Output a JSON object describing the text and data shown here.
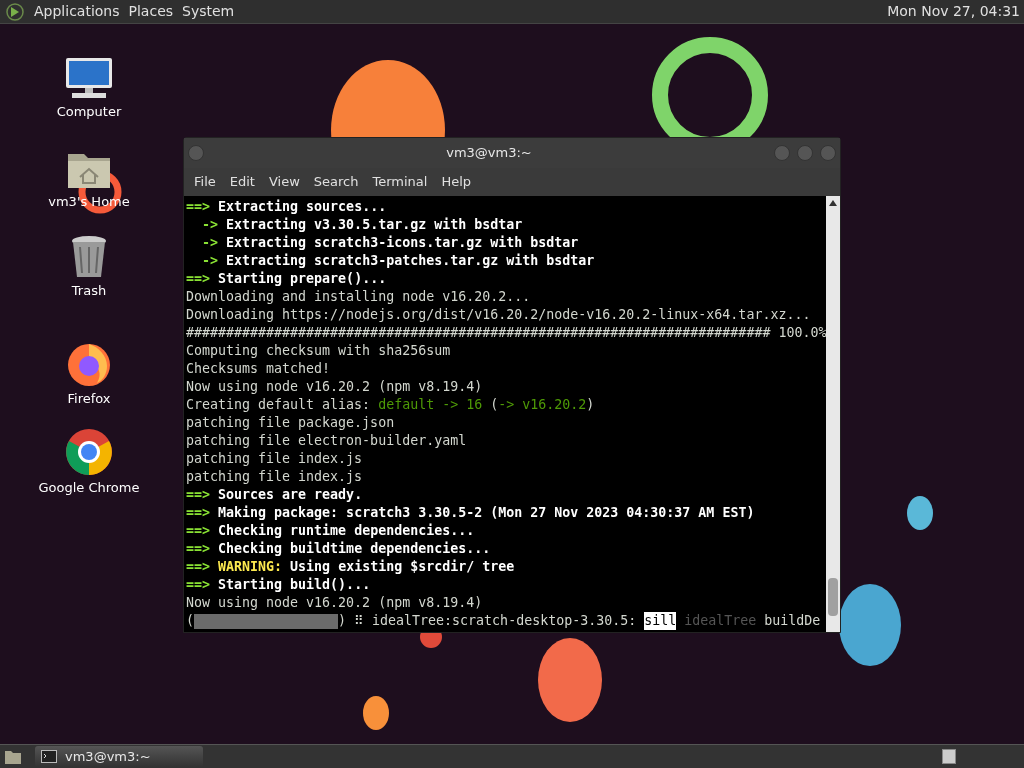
{
  "top_panel": {
    "menus": [
      "Applications",
      "Places",
      "System"
    ],
    "clock": "Mon Nov 27, 04:31"
  },
  "desktop_icons": [
    {
      "kind": "computer",
      "label": "Computer"
    },
    {
      "kind": "home",
      "label": "vm3's Home"
    },
    {
      "kind": "trash",
      "label": "Trash"
    },
    {
      "kind": "firefox",
      "label": "Firefox"
    },
    {
      "kind": "chrome",
      "label": "Google Chrome"
    }
  ],
  "window": {
    "title": "vm3@vm3:~",
    "menu": [
      "File",
      "Edit",
      "View",
      "Search",
      "Terminal",
      "Help"
    ],
    "lines": [
      [
        {
          "kind": "arrow",
          "text": "==>"
        },
        {
          "kind": "bold",
          "text": " Extracting sources..."
        }
      ],
      [
        {
          "kind": "arrow",
          "text": "  ->"
        },
        {
          "kind": "bold",
          "text": " Extracting v3.30.5.tar.gz with bsdtar"
        }
      ],
      [
        {
          "kind": "arrow",
          "text": "  ->"
        },
        {
          "kind": "bold",
          "text": " Extracting scratch3-icons.tar.gz with bsdtar"
        }
      ],
      [
        {
          "kind": "arrow",
          "text": "  ->"
        },
        {
          "kind": "bold",
          "text": " Extracting scratch3-patches.tar.gz with bsdtar"
        }
      ],
      [
        {
          "kind": "arrow",
          "text": "==>"
        },
        {
          "kind": "bold",
          "text": " Starting prepare()..."
        }
      ],
      [
        {
          "kind": "plain",
          "text": "Downloading and installing node v16.20.2..."
        }
      ],
      [
        {
          "kind": "plain",
          "text": "Downloading https://nodejs.org/dist/v16.20.2/node-v16.20.2-linux-x64.tar.xz..."
        }
      ],
      [
        {
          "kind": "plain",
          "text": "######################################################################### 100.0%"
        }
      ],
      [
        {
          "kind": "plain",
          "text": "Computing checksum with sha256sum"
        }
      ],
      [
        {
          "kind": "plain",
          "text": "Checksums matched!"
        }
      ],
      [
        {
          "kind": "plain",
          "text": "Now using node v16.20.2 (npm v8.19.4)"
        }
      ],
      [
        {
          "kind": "plain",
          "text": "Creating default alias: "
        },
        {
          "kind": "alias",
          "text": "default -> 16"
        },
        {
          "kind": "plain",
          "text": " ("
        },
        {
          "kind": "alias",
          "text": "-> v16.20.2"
        },
        {
          "kind": "plain",
          "text": ")"
        }
      ],
      [
        {
          "kind": "plain",
          "text": "patching file package.json"
        }
      ],
      [
        {
          "kind": "plain",
          "text": "patching file electron-builder.yaml"
        }
      ],
      [
        {
          "kind": "plain",
          "text": "patching file index.js"
        }
      ],
      [
        {
          "kind": "plain",
          "text": "patching file index.js"
        }
      ],
      [
        {
          "kind": "arrow",
          "text": "==>"
        },
        {
          "kind": "bold",
          "text": " Sources are ready."
        }
      ],
      [
        {
          "kind": "arrow",
          "text": "==>"
        },
        {
          "kind": "bold",
          "text": " Making package: scratch3 3.30.5-2 (Mon 27 Nov 2023 04:30:37 AM EST)"
        }
      ],
      [
        {
          "kind": "arrow",
          "text": "==>"
        },
        {
          "kind": "bold",
          "text": " Checking runtime dependencies..."
        }
      ],
      [
        {
          "kind": "arrow",
          "text": "==>"
        },
        {
          "kind": "bold",
          "text": " Checking buildtime dependencies..."
        }
      ],
      [
        {
          "kind": "arrow",
          "text": "==>"
        },
        {
          "kind": "warn",
          "text": " WARNING:"
        },
        {
          "kind": "bold",
          "text": " Using existing $srcdir/ tree"
        }
      ],
      [
        {
          "kind": "arrow",
          "text": "==>"
        },
        {
          "kind": "bold",
          "text": " Starting build()..."
        }
      ],
      [
        {
          "kind": "plain",
          "text": "Now using node v16.20.2 (npm v8.19.4)"
        }
      ]
    ],
    "progress": {
      "open": "(",
      "close": ")",
      "spinner": "⠿",
      "level": 0,
      "text": " idealTree:scratch-desktop-3.30.5: ",
      "badge": "sill",
      "dim": " idealTree",
      "tail": " buildDe"
    }
  },
  "taskbar": {
    "tasks": [
      {
        "label": "vm3@vm3:~",
        "selected": false
      }
    ]
  }
}
